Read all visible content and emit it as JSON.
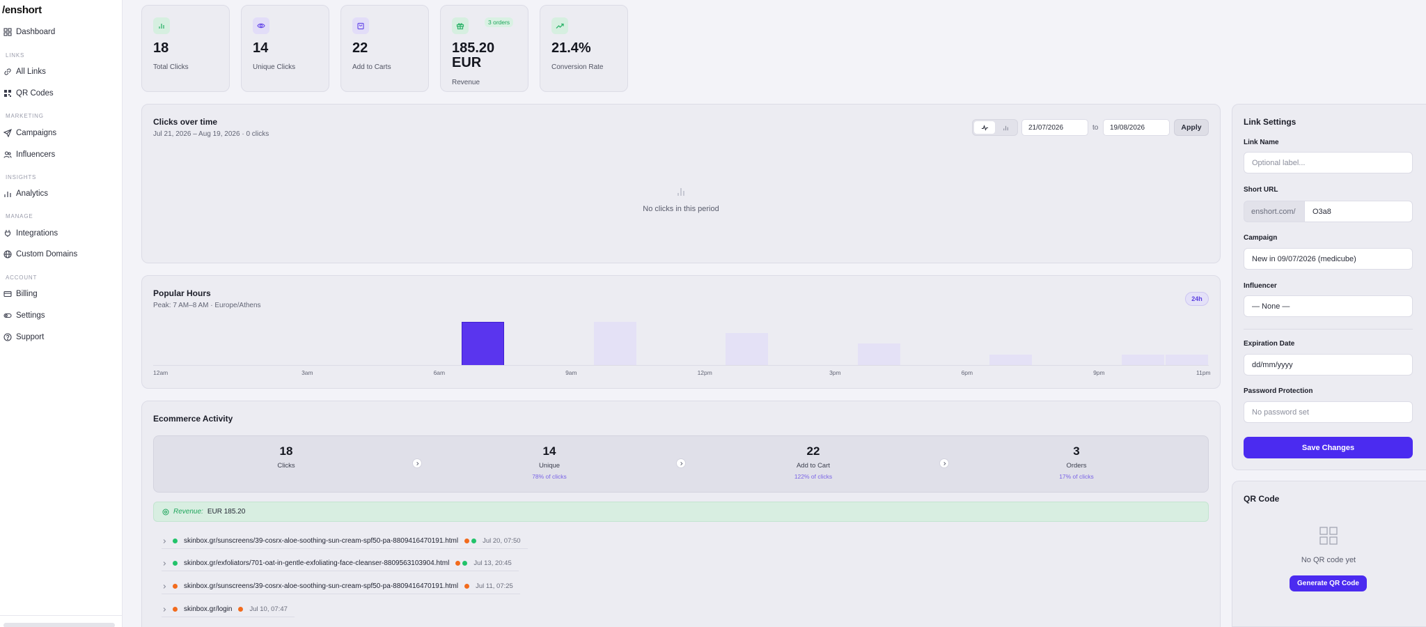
{
  "app": {
    "logo": "/enshort"
  },
  "sidebar": {
    "sections": [
      "LINKS",
      "MARKETING",
      "INSIGHTS",
      "MANAGE",
      "ACCOUNT"
    ],
    "items": [
      {
        "label": "Dashboard",
        "icon": "grid-icon"
      },
      {
        "label": "All Links",
        "icon": "link-icon"
      },
      {
        "label": "QR Codes",
        "icon": "qr-code-icon"
      },
      {
        "label": "Campaigns",
        "icon": "send-icon"
      },
      {
        "label": "Influencers",
        "icon": "users-icon"
      },
      {
        "label": "Analytics",
        "icon": "bar-chart-icon"
      },
      {
        "label": "Integrations",
        "icon": "plug-icon"
      },
      {
        "label": "Custom Domains",
        "icon": "globe-icon"
      },
      {
        "label": "Billing",
        "icon": "credit-card-icon"
      },
      {
        "label": "Settings",
        "icon": "settings-icon"
      },
      {
        "label": "Support",
        "icon": "help-icon"
      }
    ]
  },
  "stats": [
    {
      "value": "18",
      "label": "Total Clicks",
      "icon": "bar-chart-icon",
      "color": "#2fb36b"
    },
    {
      "value": "14",
      "label": "Unique Clicks",
      "icon": "eye-icon",
      "color": "#6a4ee8"
    },
    {
      "value": "22",
      "label": "Add to Carts",
      "icon": "bag-icon",
      "color": "#6a4ee8"
    },
    {
      "value": "185.20 EUR",
      "label": "Revenue",
      "icon": "gift-icon",
      "color": "#2fb36b",
      "badge": "3 orders"
    },
    {
      "value": "21.4%",
      "label": "Conversion Rate",
      "icon": "trend-up-icon",
      "color": "#2fb36b"
    }
  ],
  "clicks_over_time": {
    "title": "Clicks over time",
    "subtitle": "Jul 21, 2026 – Aug 19, 2026 · 0 clicks",
    "from_date": "21/07/2026",
    "to_label": "to",
    "to_date": "19/08/2026",
    "apply_label": "Apply",
    "empty_text": "No clicks in this period"
  },
  "popular_hours": {
    "title": "Popular Hours",
    "subtitle": "Peak: 7 AM–8 AM · Europe/Athens",
    "badge": "24h",
    "tick_labels": [
      "12am",
      "3am",
      "6am",
      "9am",
      "12pm",
      "3pm",
      "6pm",
      "9pm",
      "11pm"
    ],
    "chart_data": {
      "type": "bar",
      "categories": [
        "0",
        "1",
        "2",
        "3",
        "4",
        "5",
        "6",
        "7",
        "8",
        "9",
        "10",
        "11",
        "12",
        "13",
        "14",
        "15",
        "16",
        "17",
        "18",
        "19",
        "20",
        "21",
        "22",
        "23"
      ],
      "values": [
        0,
        0,
        0,
        0,
        0,
        0,
        0,
        4,
        0,
        0,
        4,
        0,
        0,
        3,
        0,
        0,
        2,
        0,
        0,
        1,
        0,
        0,
        1,
        1
      ],
      "ylim": [
        0,
        4
      ],
      "peak_index": 7,
      "peak_color": "#5a35ee",
      "bar_color": "#e4e1f6"
    }
  },
  "ecommerce": {
    "title": "Ecommerce Activity",
    "funnel": [
      {
        "value": "18",
        "label": "Clicks",
        "pct": ""
      },
      {
        "value": "14",
        "label": "Unique",
        "pct": "78% of clicks"
      },
      {
        "value": "22",
        "label": "Add to Cart",
        "pct": "122% of clicks"
      },
      {
        "value": "3",
        "label": "Orders",
        "pct": "17% of clicks"
      }
    ],
    "revenue_key": "Revenue:",
    "revenue_value": "EUR 185.20",
    "rows": [
      {
        "url": "skinbox.gr/sunscreens/39-cosrx-aloe-soothing-sun-cream-spf50-pa-8809416470191.html",
        "time": "Jul 20, 07:50",
        "lead": "green",
        "tags": [
          "orange",
          "green"
        ]
      },
      {
        "url": "skinbox.gr/exfoliators/701-oat-in-gentle-exfoliating-face-cleanser-8809563103904.html",
        "time": "Jul 13, 20:45",
        "lead": "green",
        "tags": [
          "orange",
          "green"
        ]
      },
      {
        "url": "skinbox.gr/sunscreens/39-cosrx-aloe-soothing-sun-cream-spf50-pa-8809416470191.html",
        "time": "Jul 11, 07:25",
        "lead": "orange",
        "tags": [
          "orange"
        ]
      },
      {
        "url": "skinbox.gr/login",
        "time": "Jul 10, 07:47",
        "lead": "orange",
        "tags": [
          "orange"
        ]
      }
    ]
  },
  "link_settings": {
    "title": "Link Settings",
    "link_name_label": "Link Name",
    "link_name_placeholder": "Optional label...",
    "short_url_label": "Short URL",
    "short_url_prefix": "enshort.com/",
    "short_url_slug": "O3a8",
    "campaign_label": "Campaign",
    "campaign_value": "New in 09/07/2026 (medicube)",
    "influencer_label": "Influencer",
    "influencer_value": "— None —",
    "expiration_label": "Expiration Date",
    "expiration_placeholder": "dd/mm/yyyy",
    "password_label": "Password Protection",
    "password_placeholder": "No password set",
    "save_label": "Save Changes"
  },
  "qr_code": {
    "title": "QR Code",
    "empty_text": "No QR code yet",
    "generate_label": "Generate QR Code"
  }
}
